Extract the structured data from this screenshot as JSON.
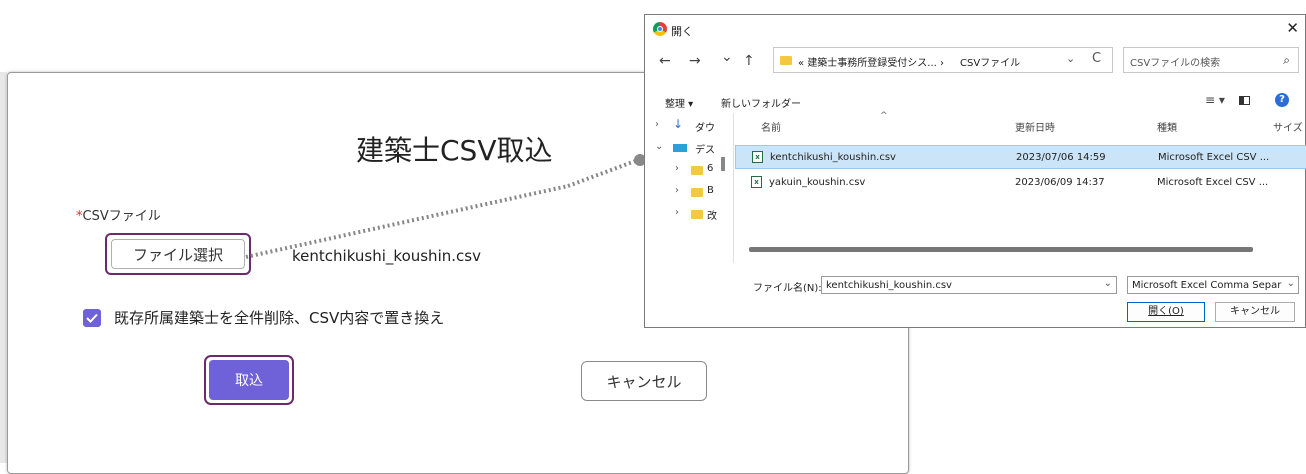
{
  "modal": {
    "title": "建築士CSV取込",
    "field_required_mark": "*",
    "field_label": "CSVファイル",
    "file_button": "ファイル選択",
    "file_name": "kentchikushi_koushin.csv",
    "checkbox_label": "既存所属建築士を全件削除、CSV内容で置き換え",
    "checkbox_checked": true,
    "import_button": "取込",
    "cancel_button": "キャンセル",
    "accent_color": "#6f62d8",
    "highlight_color": "#6b2a6b"
  },
  "dialog": {
    "title": "開く",
    "close_icon": "close-icon",
    "nav": {
      "back": "←",
      "forward": "→",
      "recent": "⌄",
      "up": "↑"
    },
    "address": {
      "prefix": "«",
      "path": "建築士事務所登録受付シス...",
      "separator": "›",
      "folder": "CSVファイル",
      "refresh": "C"
    },
    "search_placeholder": "CSVファイルの検索",
    "toolbar": {
      "organize": "整理 ▾",
      "new_folder": "新しいフォルダー",
      "view": "≡ ▾"
    },
    "tree": [
      {
        "chevron": "›",
        "label": "ダウ",
        "icon": "download-icon"
      },
      {
        "chevron": "⌄",
        "label": "デス",
        "icon": "desktop-icon"
      },
      {
        "chevron": "›",
        "label": "6",
        "icon": "folder-icon"
      },
      {
        "chevron": "›",
        "label": "B",
        "icon": "folder-icon"
      },
      {
        "chevron": "›",
        "label": "改",
        "icon": "folder-icon"
      }
    ],
    "columns": {
      "name": "名前",
      "modified": "更新日時",
      "type": "種類",
      "size": "サイズ",
      "sort_indicator": "^"
    },
    "files": [
      {
        "name": "kentchikushi_koushin.csv",
        "modified": "2023/07/06 14:59",
        "type": "Microsoft Excel CSV ...",
        "selected": true
      },
      {
        "name": "yakuin_koushin.csv",
        "modified": "2023/06/09 14:37",
        "type": "Microsoft Excel CSV ...",
        "selected": false
      }
    ],
    "filename_label": "ファイル名(N):",
    "filename_value": "kentchikushi_koushin.csv",
    "filetype_value": "Microsoft Excel Comma Separat",
    "open_button": "開く(O)",
    "cancel_button": "キャンセル"
  }
}
